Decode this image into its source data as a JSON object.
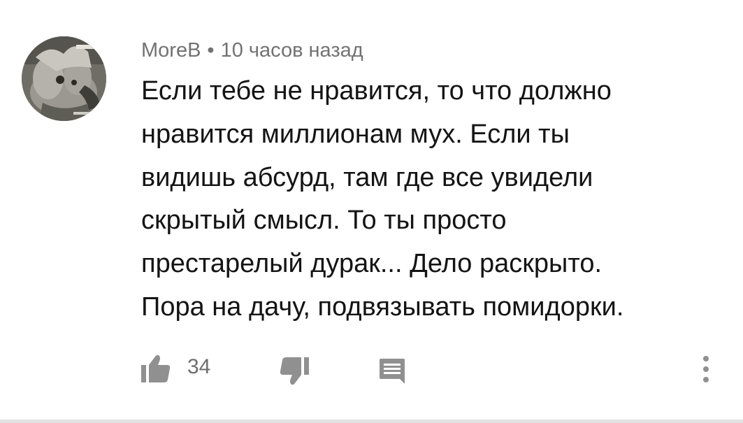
{
  "comment": {
    "author": "MoreB",
    "separator": "•",
    "timestamp": "10 часов назад",
    "text_lines": [
      "Если тебе не нравится, то что должно",
      "нравится миллионам мух. Если ты",
      "видишь абсурд, там где все увидели",
      "скрытый смысл. То ты просто",
      "престарелый дурак... Дело раскрыто.",
      "Пора на дачу, подвязывать помидорки."
    ],
    "like_count": "34"
  },
  "icons": {
    "like": "thumbs-up-icon",
    "dislike": "thumbs-down-icon",
    "reply": "reply-comment-icon",
    "more": "more-vertical-icon"
  },
  "colors": {
    "text": "#141414",
    "secondary_text": "#727272",
    "icon": "#909090",
    "divider": "#e2e2e2"
  }
}
